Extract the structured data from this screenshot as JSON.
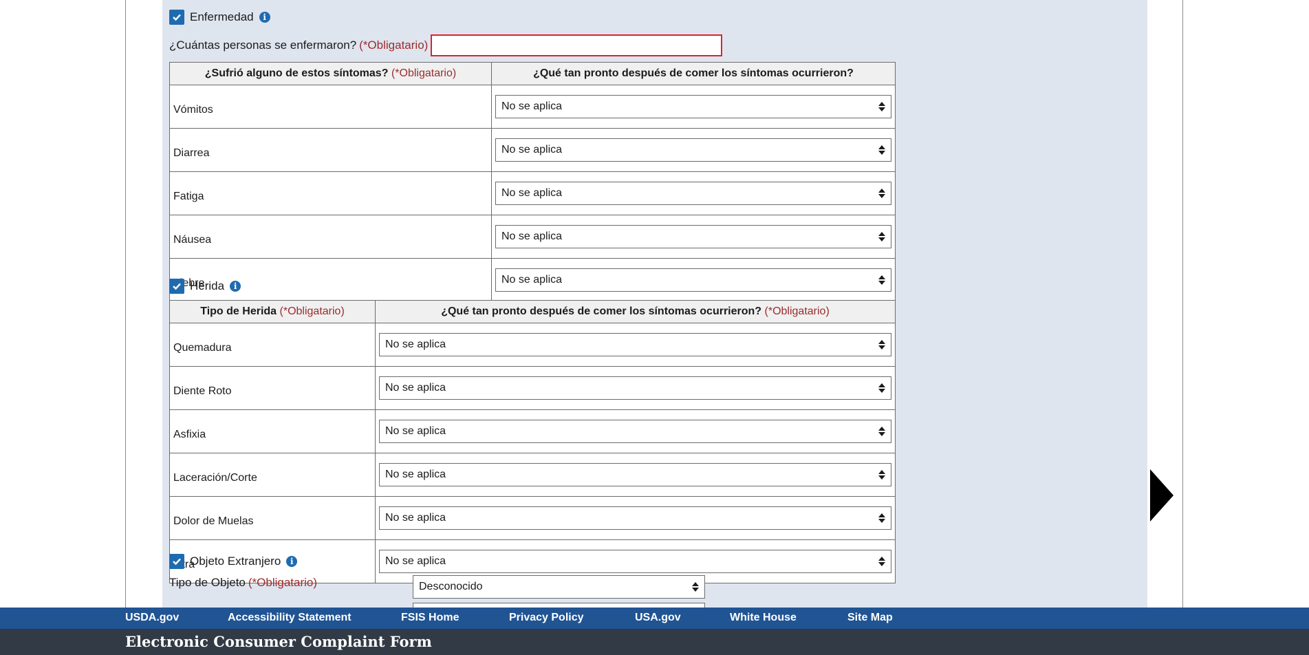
{
  "illness": {
    "label": "Enfermedad",
    "people_question": "¿Cuántas personas se enfermaron?",
    "required": "(*Obligatario)",
    "people_value": "",
    "table": {
      "header_symptoms": "¿Sufrió alguno de estos síntomas?",
      "header_required": "(*Obligatario)",
      "header_timing": "¿Qué tan pronto después de comer los síntomas ocurrieron?",
      "rows": [
        {
          "label": "Vómitos",
          "value": "No se aplica"
        },
        {
          "label": "Diarrea",
          "value": "No se aplica"
        },
        {
          "label": "Fatiga",
          "value": "No se aplica"
        },
        {
          "label": "Náusea",
          "value": "No se aplica"
        },
        {
          "label": "Fiebre",
          "value": "No se aplica"
        }
      ]
    }
  },
  "injury": {
    "label": "Herida",
    "table": {
      "header_type": "Tipo de Herida",
      "header_type_required": "(*Obligatario)",
      "header_timing": "¿Qué tan pronto después de comer los síntomas ocurrieron?",
      "header_timing_required": "(*Obligatario)",
      "rows": [
        {
          "label": "Quemadura",
          "value": "No se aplica"
        },
        {
          "label": "Diente Roto",
          "value": "No se aplica"
        },
        {
          "label": "Asfixia",
          "value": "No se aplica"
        },
        {
          "label": "Laceración/Corte",
          "value": "No se aplica"
        },
        {
          "label": "Dolor de Muelas",
          "value": "No se aplica"
        },
        {
          "label": "Otra",
          "value": "No se aplica"
        }
      ]
    }
  },
  "foreign_object": {
    "label": "Objeto Extranjero",
    "type_label": "Tipo de Objeto",
    "type_required": "(*Obligatario)",
    "type_value": "Desconocido"
  },
  "footer": {
    "links": [
      "USDA.gov",
      "Accessibility Statement",
      "FSIS Home",
      "Privacy Policy",
      "USA.gov",
      "White House",
      "Site Map"
    ],
    "title": "Electronic Consumer Complaint Form"
  },
  "colors": {
    "accent": "#1f6bb0",
    "required": "#9b2c2c",
    "nav": "#205493",
    "footer": "#323a45"
  }
}
